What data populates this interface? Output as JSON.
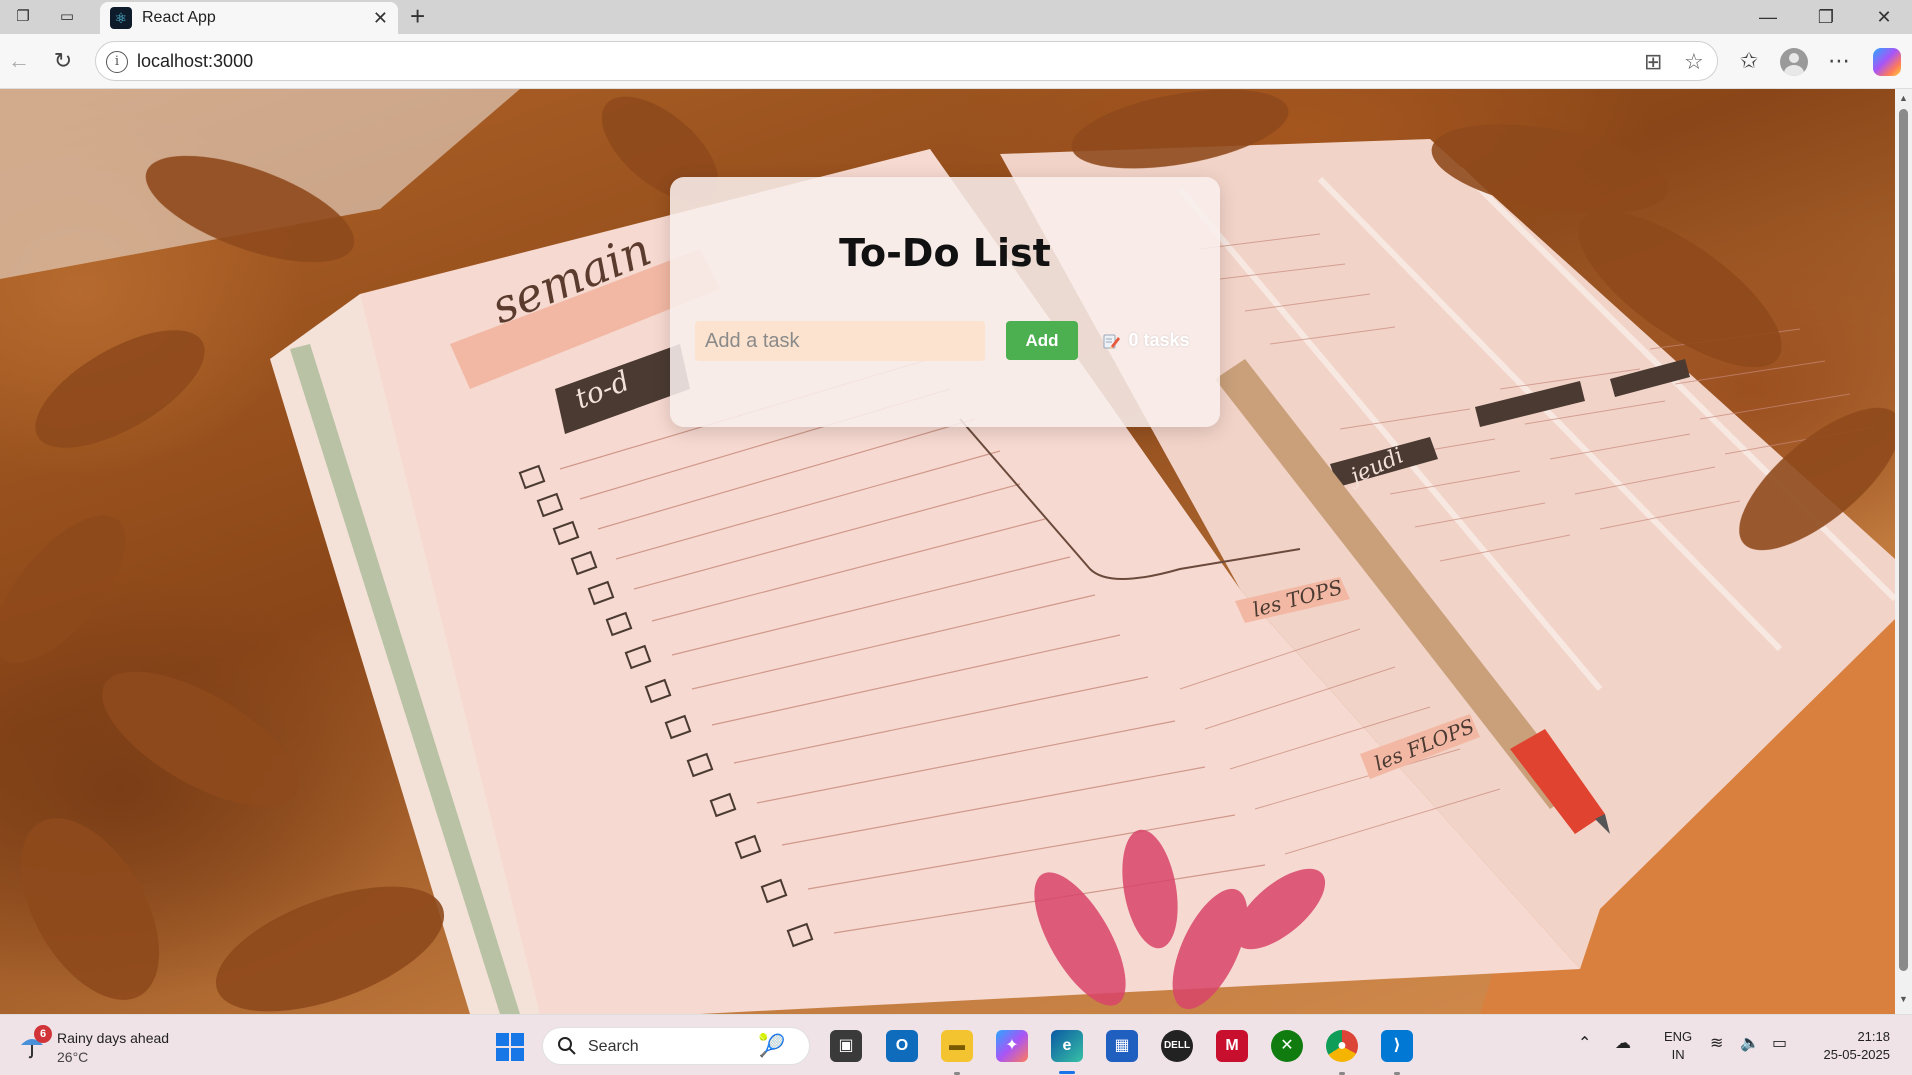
{
  "browser": {
    "tab_title": "React App",
    "url": "localhost:3000"
  },
  "app": {
    "title": "To-Do List",
    "input_placeholder": "Add a task",
    "input_value": "",
    "add_button_label": "Add",
    "task_count_label": "0 tasks"
  },
  "taskbar": {
    "weather_title": "Rainy days ahead",
    "weather_temp": "26°C",
    "weather_badge": "6",
    "search_label": "Search",
    "language_line1": "ENG",
    "language_line2": "IN",
    "time": "21:18",
    "date": "25-05-2025"
  },
  "colors": {
    "add_button": "#4caf50",
    "input_background": "#fbe3cf",
    "accent_blue": "#1a73e8"
  }
}
